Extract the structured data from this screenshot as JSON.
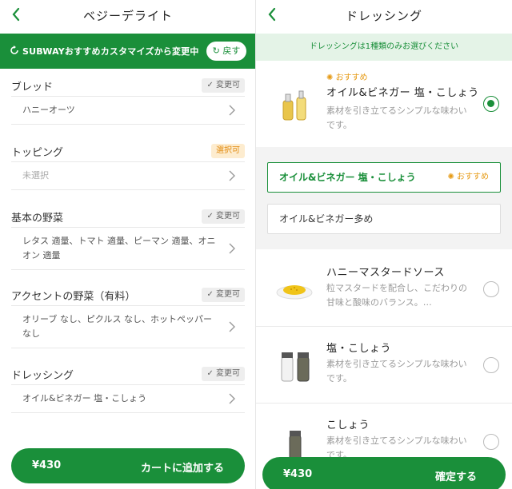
{
  "left": {
    "nav": {
      "title": "ベジーデライト"
    },
    "banner": {
      "text": "SUBWAYおすすめカスタマイズから変更中",
      "back_label": "戻す"
    },
    "sections": [
      {
        "title": "ブレッド",
        "badge": "✓ 変更可",
        "value": "ハニーオーツ"
      },
      {
        "title": "トッピング",
        "badge": "選択可",
        "value": "未選択"
      },
      {
        "title": "基本の野菜",
        "badge": "✓ 変更可",
        "value": "レタス 適量、トマト 適量、ピーマン 適量、オニオン 適量"
      },
      {
        "title": "アクセントの野菜（有料）",
        "badge": "✓ 変更可",
        "value": "オリーブ なし、ピクルス なし、ホットペッパー なし"
      },
      {
        "title": "ドレッシング",
        "badge": "✓ 変更可",
        "value": "オイル&ビネガー 塩・こしょう"
      }
    ],
    "cart": {
      "price": "¥430",
      "action": "カートに追加する"
    }
  },
  "right": {
    "nav": {
      "title": "ドレッシング"
    },
    "notice": "ドレッシングは1種類のみお選びください",
    "options": [
      {
        "recommend": "おすすめ",
        "name": "オイル&ビネガー 塩・こしょう",
        "desc": "素材を引き立てるシンプルな味わいです。",
        "selected": true,
        "icon": "oil-vinegar-bottles"
      },
      {
        "name": "ハニーマスタードソース",
        "desc": "粒マスタードを配合し、こだわりの甘味と酸味のバランス。…",
        "selected": false,
        "icon": "honey-mustard-sauce"
      },
      {
        "name": "塩・こしょう",
        "desc": "素材を引き立てるシンプルな味わいです。",
        "selected": false,
        "icon": "salt-pepper-shakers"
      },
      {
        "name": "こしょう",
        "desc": "素材を引き立てるシンプルな味わいです。",
        "selected": false,
        "icon": "pepper-shaker"
      }
    ],
    "sub_options": [
      {
        "label": "オイル&ビネガー 塩・こしょう",
        "recommend": "おすすめ",
        "selected": true
      },
      {
        "label": "オイル&ビネガー多め",
        "selected": false
      }
    ],
    "confirm": {
      "price": "¥430",
      "action": "確定する"
    }
  },
  "colors": {
    "brand_green": "#1a8f3a",
    "recommend_orange": "#e69b16",
    "notice_bg": "#e4f3e7"
  }
}
